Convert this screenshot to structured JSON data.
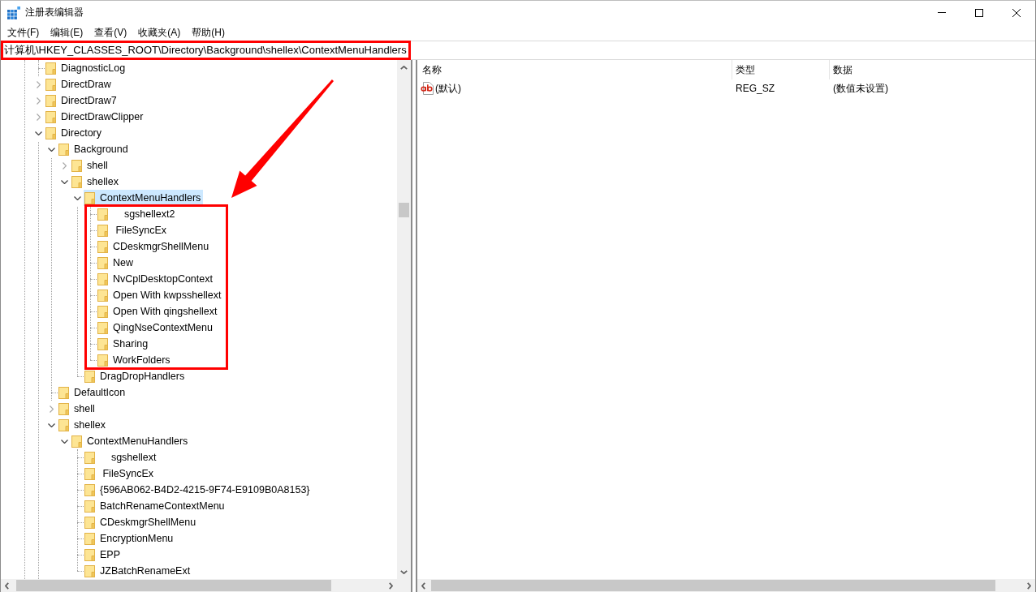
{
  "window": {
    "title": "注册表编辑器"
  },
  "menu_bar": [
    "文件(F)",
    "编辑(E)",
    "查看(V)",
    "收藏夹(A)",
    "帮助(H)"
  ],
  "address_bar": {
    "value": "计算机\\HKEY_CLASSES_ROOT\\Directory\\Background\\shellex\\ContextMenuHandlers"
  },
  "tree": [
    {
      "label": "DiagnosticLog",
      "kind": "leaf",
      "selected": false
    },
    {
      "label": "DirectDraw",
      "kind": "branch",
      "expanded": false,
      "selected": false
    },
    {
      "label": "DirectDraw7",
      "kind": "branch",
      "expanded": false,
      "selected": false
    },
    {
      "label": "DirectDrawClipper",
      "kind": "branch",
      "expanded": false,
      "selected": false
    },
    {
      "label": "Directory",
      "kind": "branch",
      "expanded": true,
      "selected": false,
      "children": [
        {
          "label": "Background",
          "kind": "branch",
          "expanded": true,
          "selected": false,
          "children": [
            {
              "label": "shell",
              "kind": "branch",
              "expanded": false,
              "selected": false
            },
            {
              "label": "shellex",
              "kind": "branch",
              "expanded": true,
              "selected": false,
              "children": [
                {
                  "label": "ContextMenuHandlers",
                  "kind": "branch",
                  "expanded": true,
                  "selected": true,
                  "children": [
                    {
                      "label": "    sgshellext2",
                      "kind": "leaf",
                      "selected": false
                    },
                    {
                      "label": " FileSyncEx",
                      "kind": "leaf",
                      "selected": false
                    },
                    {
                      "label": "CDeskmgrShellMenu",
                      "kind": "leaf",
                      "selected": false
                    },
                    {
                      "label": "New",
                      "kind": "leaf",
                      "selected": false
                    },
                    {
                      "label": "NvCplDesktopContext",
                      "kind": "leaf",
                      "selected": false
                    },
                    {
                      "label": "Open With kwpsshellext",
                      "kind": "leaf",
                      "selected": false
                    },
                    {
                      "label": "Open With qingshellext",
                      "kind": "leaf",
                      "selected": false
                    },
                    {
                      "label": "QingNseContextMenu",
                      "kind": "leaf",
                      "selected": false
                    },
                    {
                      "label": "Sharing",
                      "kind": "leaf",
                      "selected": false
                    },
                    {
                      "label": "WorkFolders",
                      "kind": "leaf",
                      "selected": false
                    }
                  ]
                },
                {
                  "label": "DragDropHandlers",
                  "kind": "leaf",
                  "selected": false
                }
              ]
            }
          ]
        },
        {
          "label": "DefaultIcon",
          "kind": "leaf",
          "selected": false
        },
        {
          "label": "shell",
          "kind": "branch",
          "expanded": false,
          "selected": false
        },
        {
          "label": "shellex",
          "kind": "branch",
          "expanded": true,
          "selected": false,
          "children": [
            {
              "label": "ContextMenuHandlers",
              "kind": "branch",
              "expanded": true,
              "selected": false,
              "children": [
                {
                  "label": "    sgshellext",
                  "kind": "leaf",
                  "selected": false
                },
                {
                  "label": " FileSyncEx",
                  "kind": "leaf",
                  "selected": false
                },
                {
                  "label": "{596AB062-B4D2-4215-9F74-E9109B0A8153}",
                  "kind": "leaf",
                  "selected": false
                },
                {
                  "label": "BatchRenameContextMenu",
                  "kind": "leaf",
                  "selected": false
                },
                {
                  "label": "CDeskmgrShellMenu",
                  "kind": "leaf",
                  "selected": false
                },
                {
                  "label": "EncryptionMenu",
                  "kind": "leaf",
                  "selected": false
                },
                {
                  "label": "EPP",
                  "kind": "leaf",
                  "selected": false
                },
                {
                  "label": "JZBatchRenameExt",
                  "kind": "leaf",
                  "selected": false
                }
              ]
            }
          ]
        }
      ]
    }
  ],
  "values": {
    "columns": [
      "名称",
      "类型",
      "数据"
    ],
    "rows": [
      {
        "name": "(默认)",
        "type": "REG_SZ",
        "data": "(数值未设置)"
      }
    ]
  }
}
